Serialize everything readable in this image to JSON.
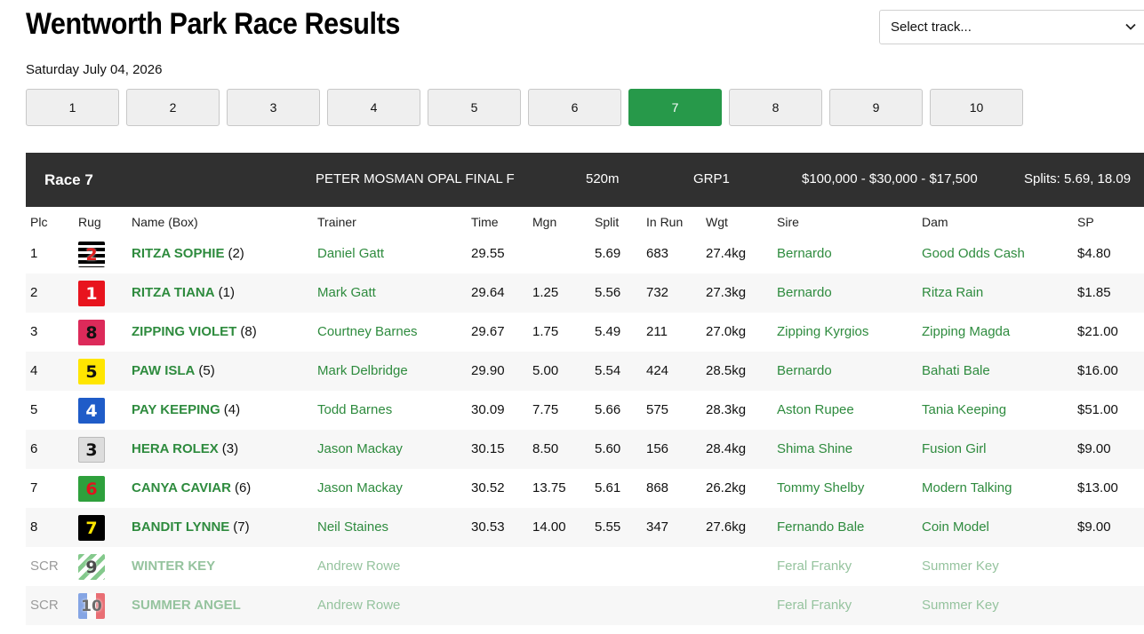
{
  "page": {
    "title": "Wentworth Park Race Results",
    "date": "Saturday July 04, 2026"
  },
  "track_select": {
    "placeholder": "Select track..."
  },
  "race_tabs": [
    "1",
    "2",
    "3",
    "4",
    "5",
    "6",
    "7",
    "8",
    "9",
    "10"
  ],
  "active_race_tab": "7",
  "race": {
    "label": "Race 7",
    "name": "PETER MOSMAN OPAL FINAL F",
    "distance": "520m",
    "grade": "GRP1",
    "prizes": "$100,000 - $30,000 - $17,500",
    "splits": "Splits: 5.69, 18.09"
  },
  "columns": [
    "Plc",
    "Rug",
    "Name (Box)",
    "Trainer",
    "Time",
    "Mgn",
    "Split",
    "In Run",
    "Wgt",
    "Sire",
    "Dam",
    "SP"
  ],
  "results": [
    {
      "plc": "1",
      "rug": "2",
      "rug_bg": "#000000",
      "rug_fg": "#e02020",
      "rug_style": "stripes-bw",
      "name": "RITZA SOPHIE",
      "box": "(2)",
      "trainer": "Daniel Gatt",
      "time": "29.55",
      "mgn": "",
      "split": "5.69",
      "inrun": "683",
      "wgt": "27.4kg",
      "sire": "Bernardo",
      "dam": "Good Odds Cash",
      "sp": "$4.80"
    },
    {
      "plc": "2",
      "rug": "1",
      "rug_bg": "#e8141e",
      "rug_fg": "#ffffff",
      "rug_style": "solid",
      "name": "RITZA TIANA",
      "box": "(1)",
      "trainer": "Mark Gatt",
      "time": "29.64",
      "mgn": "1.25",
      "split": "5.56",
      "inrun": "732",
      "wgt": "27.3kg",
      "sire": "Bernardo",
      "dam": "Ritza Rain",
      "sp": "$1.85"
    },
    {
      "plc": "3",
      "rug": "8",
      "rug_bg": "#dc2a5a",
      "rug_fg": "#111111",
      "rug_style": "solid",
      "name": "ZIPPING VIOLET",
      "box": "(8)",
      "trainer": "Courtney Barnes",
      "time": "29.67",
      "mgn": "1.75",
      "split": "5.49",
      "inrun": "211",
      "wgt": "27.0kg",
      "sire": "Zipping Kyrgios",
      "dam": "Zipping Magda",
      "sp": "$21.00"
    },
    {
      "plc": "4",
      "rug": "5",
      "rug_bg": "#ffe600",
      "rug_fg": "#111111",
      "rug_style": "solid",
      "name": "PAW ISLA",
      "box": "(5)",
      "trainer": "Mark Delbridge",
      "time": "29.90",
      "mgn": "5.00",
      "split": "5.54",
      "inrun": "424",
      "wgt": "28.5kg",
      "sire": "Bernardo",
      "dam": "Bahati Bale",
      "sp": "$16.00"
    },
    {
      "plc": "5",
      "rug": "4",
      "rug_bg": "#1f5cc8",
      "rug_fg": "#ffffff",
      "rug_style": "solid",
      "name": "PAY KEEPING",
      "box": "(4)",
      "trainer": "Todd Barnes",
      "time": "30.09",
      "mgn": "7.75",
      "split": "5.66",
      "inrun": "575",
      "wgt": "28.3kg",
      "sire": "Aston Rupee",
      "dam": "Tania Keeping",
      "sp": "$51.00"
    },
    {
      "plc": "6",
      "rug": "3",
      "rug_bg": "#dddddd",
      "rug_fg": "#111111",
      "rug_style": "solid",
      "name": "HERA ROLEX",
      "box": "(3)",
      "trainer": "Jason Mackay",
      "time": "30.15",
      "mgn": "8.50",
      "split": "5.60",
      "inrun": "156",
      "wgt": "28.4kg",
      "sire": "Shima Shine",
      "dam": "Fusion Girl",
      "sp": "$9.00"
    },
    {
      "plc": "7",
      "rug": "6",
      "rug_bg": "#2ea03c",
      "rug_fg": "#e0141e",
      "rug_style": "solid",
      "name": "CANYA CAVIAR",
      "box": "(6)",
      "trainer": "Jason Mackay",
      "time": "30.52",
      "mgn": "13.75",
      "split": "5.61",
      "inrun": "868",
      "wgt": "26.2kg",
      "sire": "Tommy Shelby",
      "dam": "Modern Talking",
      "sp": "$13.00"
    },
    {
      "plc": "8",
      "rug": "7",
      "rug_bg": "#000000",
      "rug_fg": "#ffe600",
      "rug_style": "solid",
      "name": "BANDIT LYNNE",
      "box": "(7)",
      "trainer": "Neil Staines",
      "time": "30.53",
      "mgn": "14.00",
      "split": "5.55",
      "inrun": "347",
      "wgt": "27.6kg",
      "sire": "Fernando Bale",
      "dam": "Coin Model",
      "sp": "$9.00"
    },
    {
      "plc": "SCR",
      "rug": "9",
      "rug_bg": "#3aa548",
      "rug_fg": "#111111",
      "rug_style": "stripes-gw",
      "name": "WINTER KEY",
      "box": "",
      "trainer": "Andrew Rowe",
      "time": "",
      "mgn": "",
      "split": "",
      "inrun": "",
      "wgt": "",
      "sire": "Feral Franky",
      "dam": "Summer Key",
      "sp": ""
    },
    {
      "plc": "SCR",
      "rug": "10",
      "rug_bg": "#e0141e",
      "rug_fg": "#111111",
      "rug_style": "halves-rb",
      "name": "SUMMER ANGEL",
      "box": "",
      "trainer": "Andrew Rowe",
      "time": "",
      "mgn": "",
      "split": "",
      "inrun": "",
      "wgt": "",
      "sire": "Feral Franky",
      "dam": "Summer Key",
      "sp": ""
    }
  ]
}
